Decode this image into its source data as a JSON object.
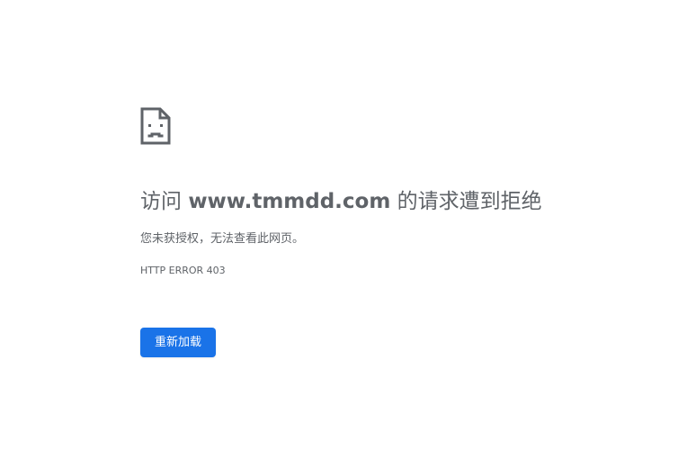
{
  "page": {
    "icon": "sad-document-icon",
    "title_prefix": "访问 ",
    "host": "www.tmmdd.com",
    "title_suffix": " 的请求遭到拒绝",
    "message": "您未获授权，无法查看此网页。",
    "error_code": "HTTP ERROR 403",
    "reload_label": "重新加载"
  },
  "colors": {
    "background": "#ffffff",
    "text": "#5f6368",
    "button": "#1a73e8",
    "button_text": "#ffffff",
    "icon": "#5f6368"
  }
}
